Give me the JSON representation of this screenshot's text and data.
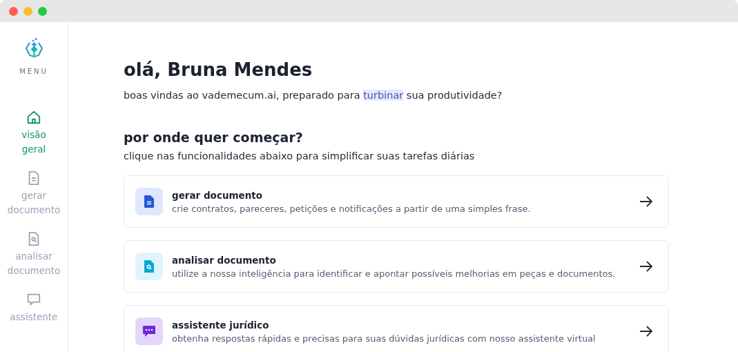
{
  "sidebar": {
    "menu_label": "MENU",
    "items": [
      {
        "kind": "home",
        "label": "visão geral",
        "selected": true
      },
      {
        "kind": "document",
        "label": "gerar documento",
        "selected": false
      },
      {
        "kind": "search-document",
        "label": "analisar documento",
        "selected": false
      },
      {
        "kind": "chat",
        "label": "assistente",
        "selected": false
      }
    ]
  },
  "greeting": "olá, Bruna Mendes",
  "subtitle": [
    {
      "text": "boas vindas ao vademecum.ai, preparado para ",
      "highlight": false
    },
    {
      "text": "turbinar",
      "highlight": true
    },
    {
      "text": " sua produtividade?",
      "highlight": false
    }
  ],
  "section": {
    "title": "por onde quer começar?",
    "description": "clique nas funcionalidades abaixo para simplificar suas tarefas diárias"
  },
  "cards": [
    {
      "kind": "document",
      "title": "gerar documento",
      "description": "crie contratos, pareceres, petições e notificações a partir de uma simples frase."
    },
    {
      "kind": "search-document",
      "title": "analisar documento",
      "description": "utilize a nossa inteligência para identificar e apontar possíveis melhorias em peças e documentos."
    },
    {
      "kind": "chat",
      "title": "assistente jurídico",
      "description": "obtenha respostas rápidas e precisas para suas dúvidas jurídicas com nosso assistente virtual"
    }
  ]
}
